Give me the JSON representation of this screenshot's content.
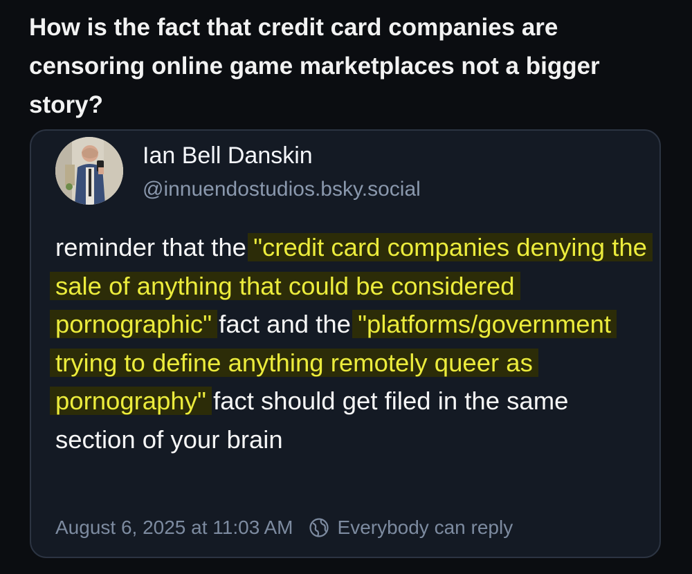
{
  "headline": "How is the fact that credit card companies are censoring online game marketplaces not a bigger story?",
  "post": {
    "author_name": "Ian Bell Danskin",
    "author_handle": "@innuendostudios.bsky.social",
    "avatar_icon": "profile-photo-avatar",
    "body": {
      "part1": "reminder that the ",
      "highlight1": "\"credit card companies denying the sale of anything that could be considered pornographic\"",
      "part2": " fact and the ",
      "highlight2": "\"platforms/government trying to define anything remotely queer as pornography\"",
      "part3": " fact should get filed in the same section of your brain"
    },
    "timestamp": "August 6, 2025 at 11:03 AM",
    "reply_setting_icon": "globe-icon",
    "reply_setting": "Everybody can reply"
  },
  "colors": {
    "background": "#0b0d11",
    "card_background": "#141a24",
    "card_border": "#2c3442",
    "highlight_background": "#2c2c08",
    "highlight_text": "#ecec3c",
    "muted_text": "#7d8ba0"
  }
}
